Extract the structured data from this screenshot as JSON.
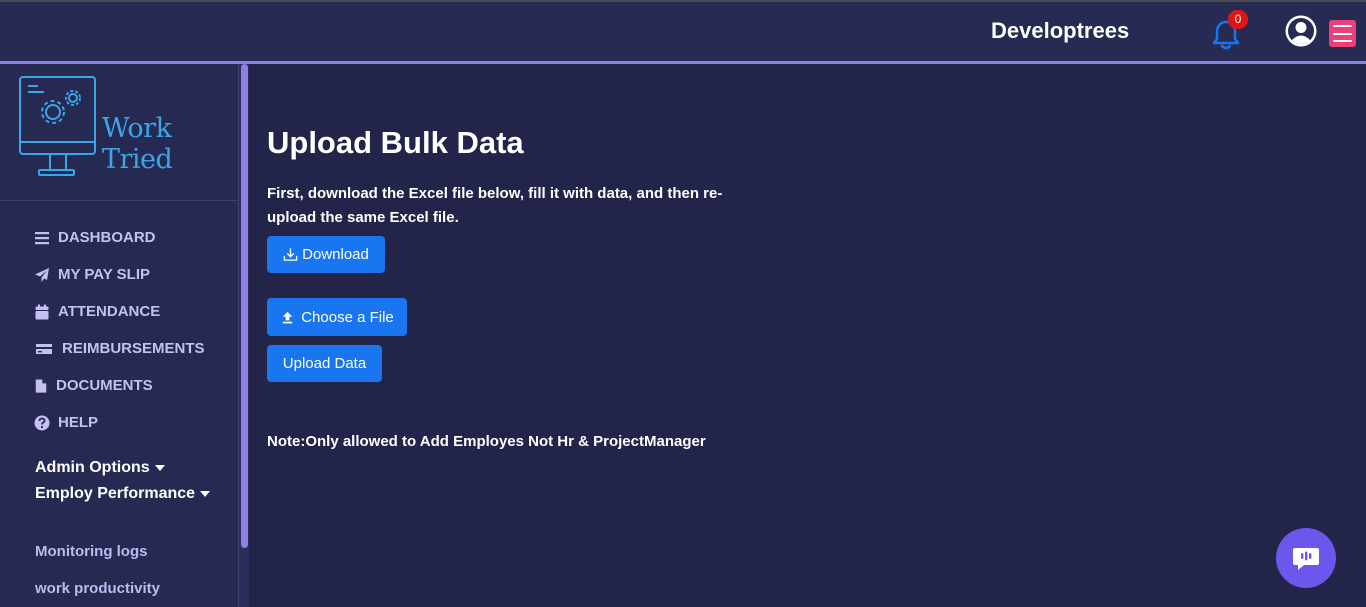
{
  "header": {
    "brand": "Developtrees",
    "notification_count": "0"
  },
  "sidebar": {
    "logo_text": "Work Tried",
    "nav_items": [
      {
        "label": "DASHBOARD",
        "icon": "list-icon"
      },
      {
        "label": "MY PAY SLIP",
        "icon": "paper-plane-icon"
      },
      {
        "label": "ATTENDANCE",
        "icon": "calendar-icon"
      },
      {
        "label": "REIMBURSEMENTS",
        "icon": "credit-card-icon"
      },
      {
        "label": "DOCUMENTS",
        "icon": "file-icon"
      },
      {
        "label": "HELP",
        "icon": "question-circle-icon"
      }
    ],
    "sections": [
      {
        "label": "Admin Options"
      },
      {
        "label": "Employ Performance"
      }
    ],
    "links": [
      {
        "label": "Monitoring logs"
      },
      {
        "label": "work productivity"
      }
    ]
  },
  "main": {
    "title": "Upload Bulk Data",
    "instructions": "First, download the Excel file below, fill it with data, and then re-upload the same Excel file.",
    "download_label": "Download",
    "choose_file_label": "Choose a File",
    "upload_label": "Upload Data",
    "note": "Note:Only allowed to Add Employes Not Hr & ProjectManager"
  },
  "colors": {
    "background": "#22244a",
    "topbar": "#272a52",
    "accent": "#8d7fe6",
    "primary_button": "#1a76f0",
    "menu_button": "#ec407a",
    "chat_button": "#6c57ec"
  }
}
